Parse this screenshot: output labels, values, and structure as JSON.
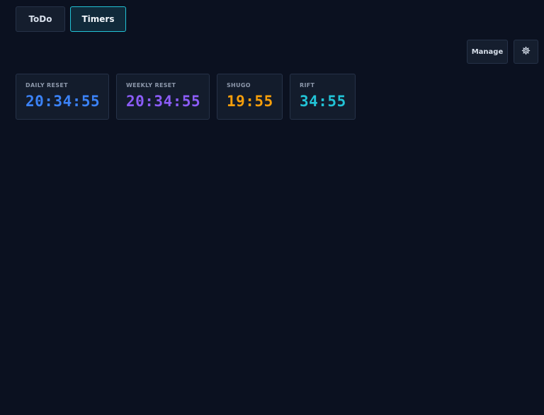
{
  "tabs": [
    {
      "label": "ToDo",
      "active": false
    },
    {
      "label": "Timers",
      "active": true
    }
  ],
  "toolbar": {
    "manage_label": "Manage",
    "settings_icon": "gear-icon"
  },
  "timers": [
    {
      "label": "DAILY RESET",
      "value": "20:34:55",
      "color": "#3b82f6"
    },
    {
      "label": "WEEKLY RESET",
      "value": "20:34:55",
      "color": "#8b5cf6"
    },
    {
      "label": "SHUGO",
      "value": "19:55",
      "color": "#f59e0b"
    },
    {
      "label": "RIFT",
      "value": "34:55",
      "color": "#22c3d6"
    }
  ],
  "colors": {
    "background": "#0b1120",
    "card": "#131c2c",
    "border": "#263248",
    "accent": "#22c3d6"
  }
}
